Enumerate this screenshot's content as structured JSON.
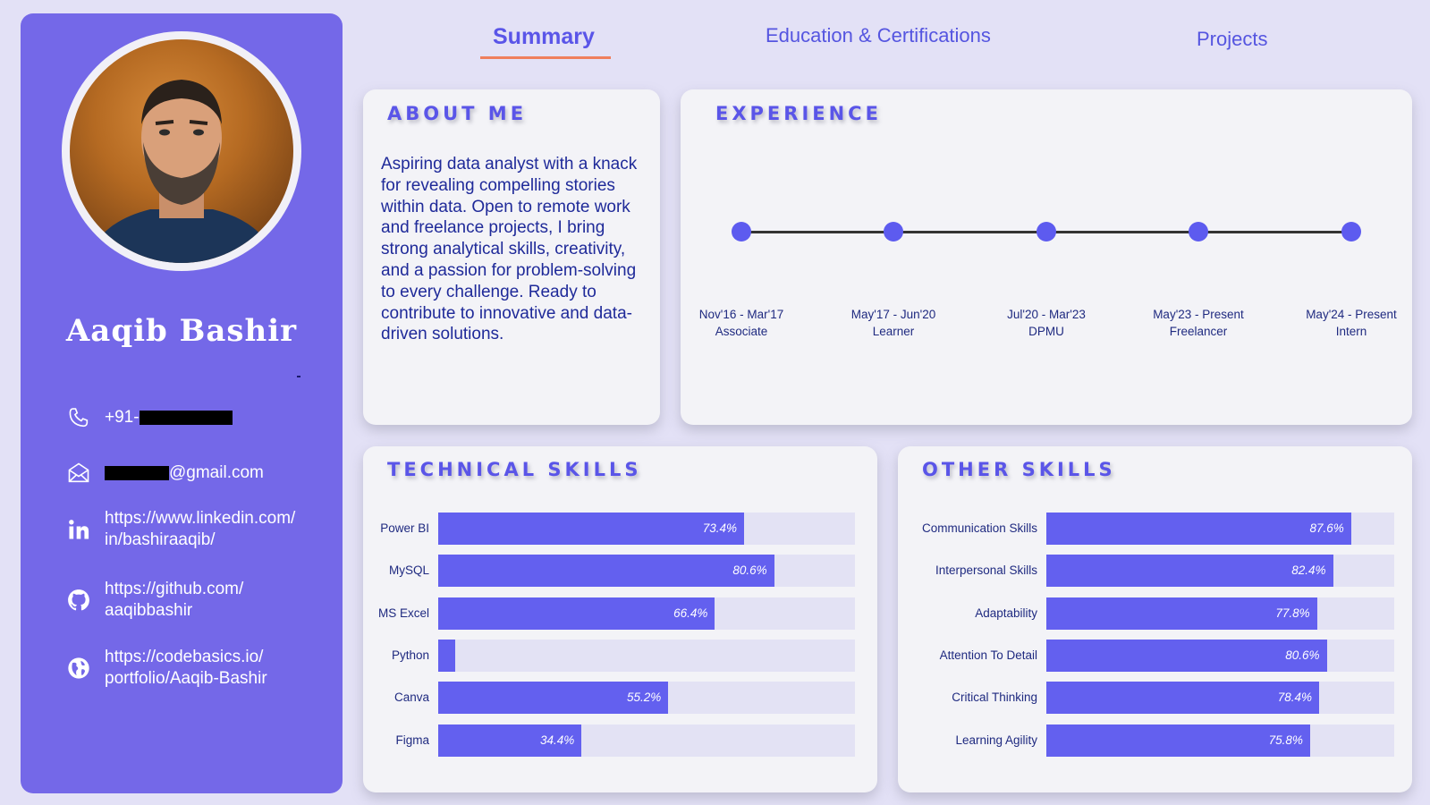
{
  "tabs": {
    "summary": "Summary",
    "education": "Education & Certifications",
    "projects": "Projects"
  },
  "profile": {
    "name": "Aaqib Bashir",
    "phone": "+91-",
    "email_suffix": "@gmail.com",
    "linkedin": "https://www.linkedin.com/\nin/bashiraaqib/",
    "github": "https://github.com/\naaqibbashir",
    "portfolio": "https://codebasics.io/\nportfolio/Aaqib-Bashir"
  },
  "about": {
    "title": "ABOUT ME",
    "text": "Aspiring data analyst with a knack for revealing compelling stories within data. Open to remote work and freelance projects, I bring strong analytical skills, creativity, and a passion for problem-solving to every challenge. Ready to contribute to innovative and data-driven solutions."
  },
  "experience": {
    "title": "EXPERIENCE",
    "items": [
      {
        "period": "Nov'16 - Mar'17",
        "role": "Associate"
      },
      {
        "period": "May'17 - Jun'20",
        "role": "Learner"
      },
      {
        "period": "Jul'20 - Mar'23",
        "role": "DPMU"
      },
      {
        "period": "May'23 - Present",
        "role": "Freelancer"
      },
      {
        "period": "May'24 - Present",
        "role": "Intern"
      }
    ]
  },
  "technical_skills": {
    "title": "TECHNICAL SKILLS",
    "items": [
      {
        "label": "Power BI",
        "value": 73.4,
        "text": "73.4%"
      },
      {
        "label": "MySQL",
        "value": 80.6,
        "text": "80.6%"
      },
      {
        "label": "MS Excel",
        "value": 66.4,
        "text": "66.4%"
      },
      {
        "label": "Python",
        "value": 4,
        "text": ""
      },
      {
        "label": "Canva",
        "value": 55.2,
        "text": "55.2%"
      },
      {
        "label": "Figma",
        "value": 34.4,
        "text": "34.4%"
      }
    ]
  },
  "other_skills": {
    "title": "OTHER SKILLS",
    "items": [
      {
        "label": "Communication Skills",
        "value": 87.6,
        "text": "87.6%"
      },
      {
        "label": "Interpersonal Skills",
        "value": 82.4,
        "text": "82.4%"
      },
      {
        "label": "Adaptability",
        "value": 77.8,
        "text": "77.8%"
      },
      {
        "label": "Attention To Detail",
        "value": 80.6,
        "text": "80.6%"
      },
      {
        "label": "Critical Thinking",
        "value": 78.4,
        "text": "78.4%"
      },
      {
        "label": "Learning Agility",
        "value": 75.8,
        "text": "75.8%"
      }
    ]
  },
  "colors": {
    "sidebar": "#7468e8",
    "accent": "#5a55e8",
    "bar": "#6360ef",
    "underline": "#ef7f5d"
  }
}
